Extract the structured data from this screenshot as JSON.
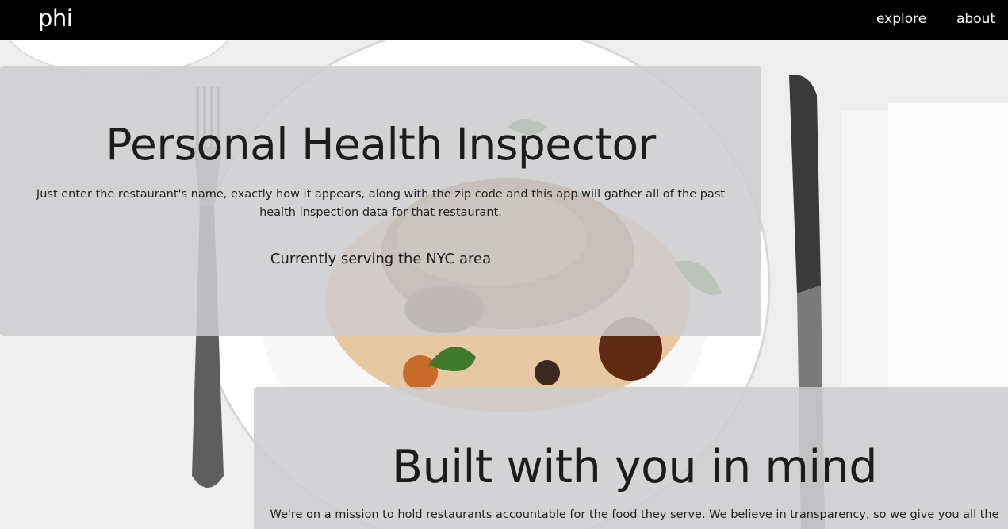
{
  "navbar": {
    "brand": "phi",
    "links": [
      {
        "label": "explore"
      },
      {
        "label": "about"
      }
    ]
  },
  "hero": {
    "title": "Personal Health Inspector",
    "description": "Just enter the restaurant's name, exactly how it appears, along with the zip code and this app will gather all of the past health inspection data for that restaurant.",
    "subtitle": "Currently serving the NYC area"
  },
  "mission": {
    "title": "Built with you in mind",
    "text": "We're on a mission to hold restaurants accountable for the food they serve. We believe in transparency, so we give you all the"
  },
  "colors": {
    "navbar_bg": "#000000",
    "nav_text": "#ffffff",
    "panel_bg": "#cdcdcf",
    "text": "#1c1c1c"
  }
}
